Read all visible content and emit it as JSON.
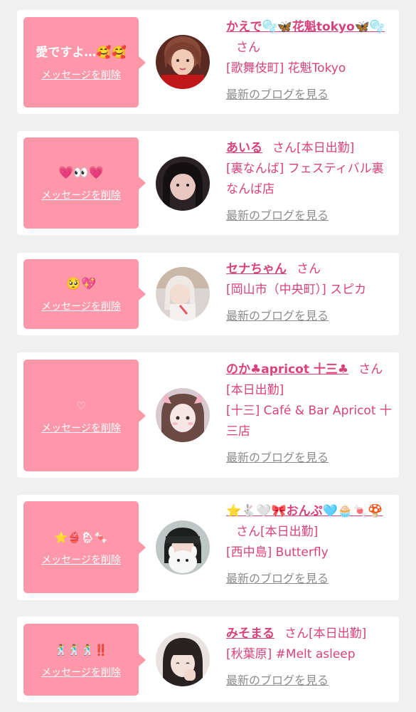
{
  "colors": {
    "background": "#f0f0f1",
    "card": "#ffffff",
    "bubble": "#fd97a9",
    "accent": "#d8427a",
    "muted_link": "#8c8c8c"
  },
  "cards": [
    {
      "message": "愛ですよ…🥰🥰",
      "delete_label": "メッセージを削除",
      "name": "かえで🫧🦋花魁tokyo🦋🫧",
      "suffix": "さん",
      "shop": "[歌舞伎町] 花魁Tokyo",
      "blog_label": "最新のブログを見る",
      "avatar_icon": "girl-photo-avatar"
    },
    {
      "message": "💗👀💗",
      "delete_label": "メッセージを削除",
      "name": "あいる",
      "suffix": "さん[本日出勤]",
      "shop": "[裏なんば] フェスティバル裏なんば店",
      "blog_label": "最新のブログを見る",
      "avatar_icon": "girl-photo-avatar"
    },
    {
      "message": "🥺💖",
      "delete_label": "メッセージを削除",
      "name": "セナちゃん",
      "suffix": "さん",
      "shop": "[岡山市（中央町）] スピカ",
      "blog_label": "最新のブログを見る",
      "avatar_icon": "girl-photo-avatar"
    },
    {
      "message": "♡",
      "delete_label": "メッセージを削除",
      "name": "のか♣apricot 十三♣",
      "suffix": "さん",
      "status": "[本日出勤]",
      "shop": "[十三] Café & Bar Apricot 十三店",
      "blog_label": "最新のブログを見る",
      "avatar_icon": "girl-photo-avatar"
    },
    {
      "message": "⭐👙🌦🍬",
      "delete_label": "メッセージを削除",
      "name": "⭐🐇🤍🎀おんぷ🩵🧁🍬🍄",
      "suffix": "さん[本日出勤]",
      "shop": "[西中島] Butterfly",
      "blog_label": "最新のブログを見る",
      "avatar_icon": "girl-photo-avatar"
    },
    {
      "message": "🕺🕺🕺‼️",
      "delete_label": "メッセージを削除",
      "name": "みそまる",
      "suffix": "さん[本日出勤]",
      "shop": "[秋葉原] #Melt asleep",
      "blog_label": "最新のブログを見る",
      "avatar_icon": "girl-photo-avatar"
    }
  ]
}
